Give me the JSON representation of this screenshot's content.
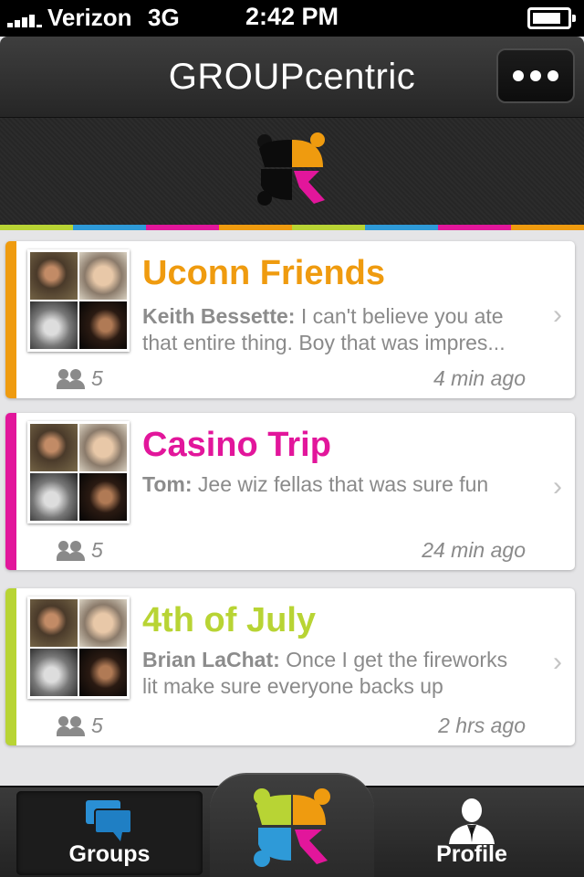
{
  "status": {
    "carrier": "Verizon",
    "network": "3G",
    "time": "2:42 PM"
  },
  "nav": {
    "title": "GROUPcentric"
  },
  "colors": {
    "orange": "#ef9b0f",
    "pink": "#e2169b",
    "lime": "#b8d434",
    "blue": "#2e9ad8"
  },
  "groups": [
    {
      "name": "Uconn Friends",
      "color": "#ef9b0f",
      "sender": "Keith Bessette:",
      "message_line1": "I can't believe you ate",
      "message_line2": "that entire thing.  Boy that was impres...",
      "members": "5",
      "time": "4 min ago"
    },
    {
      "name": "Casino Trip",
      "color": "#e2169b",
      "sender": "Tom:",
      "message_line1": "Jee wiz fellas that was sure fun",
      "message_line2": "",
      "members": "5",
      "time": "24 min ago"
    },
    {
      "name": "4th of July",
      "color": "#b8d434",
      "sender": "Brian LaChat:",
      "message_line1": "Once I get the fireworks",
      "message_line2": "lit make sure everyone backs up",
      "members": "5",
      "time": "2 hrs ago"
    }
  ],
  "tabs": {
    "groups": "Groups",
    "profile": "Profile"
  },
  "icons": {
    "more": "ellipsis-icon",
    "chevron": "chevron-right-icon",
    "members": "people-icon",
    "groups": "chat-bubbles-icon",
    "profile": "person-icon"
  }
}
